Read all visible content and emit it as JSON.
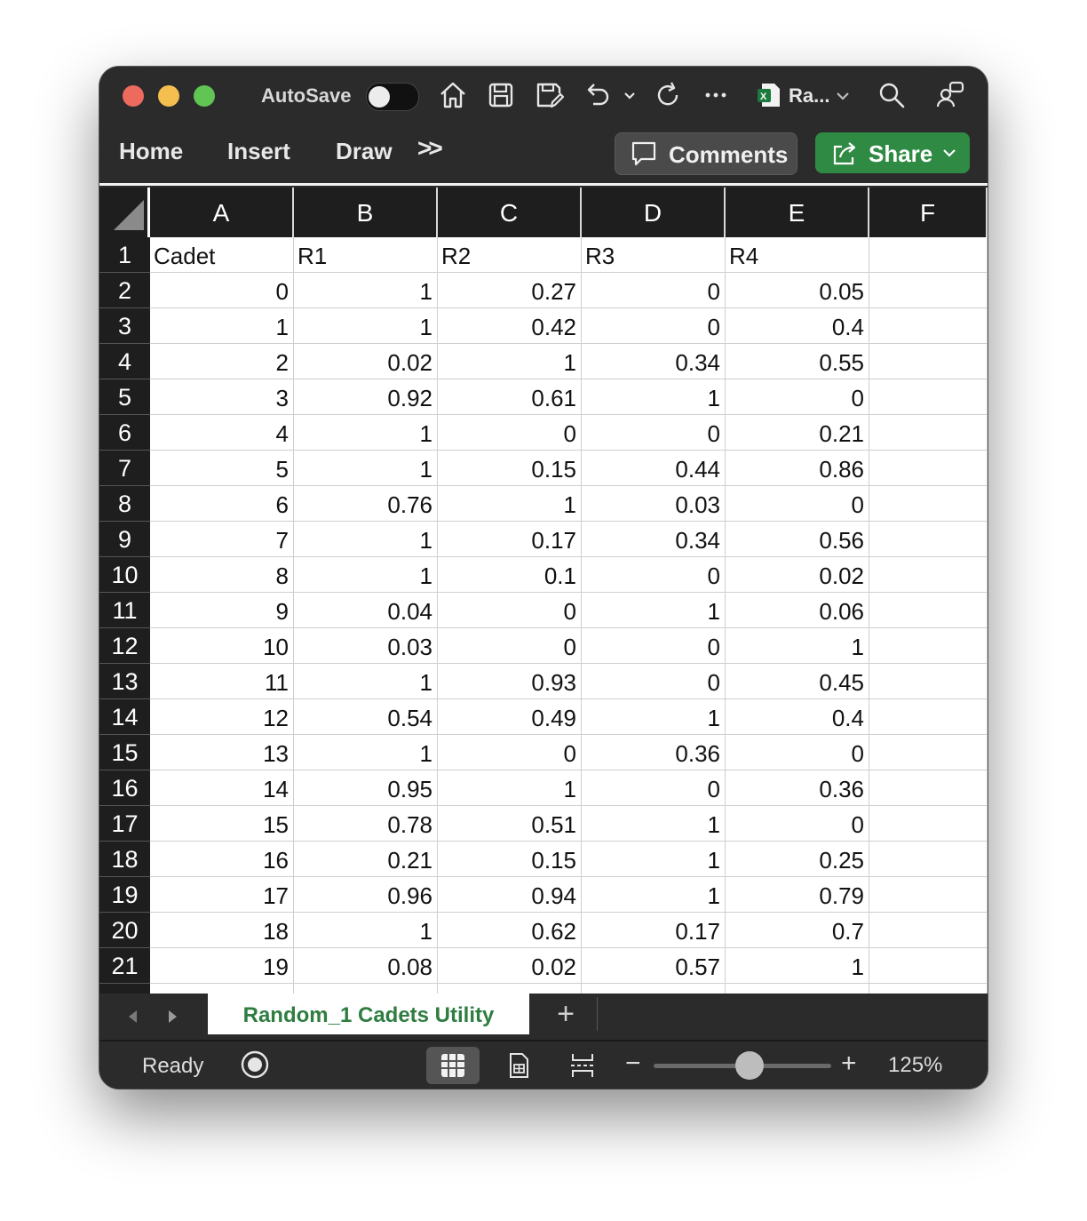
{
  "titlebar": {
    "autosave_label": "AutoSave",
    "autosave_on": false,
    "doc_title": "Ra...",
    "icons": [
      "home-icon",
      "save-icon",
      "save-as-icon",
      "undo-icon",
      "chevron-down-icon",
      "redo-icon",
      "more-icon",
      "excel-file-icon",
      "search-icon",
      "people-icon"
    ]
  },
  "ribbon": {
    "tabs": [
      "Home",
      "Insert",
      "Draw"
    ],
    "more_label": ">>",
    "comments_label": "Comments",
    "share_label": "Share",
    "share_color": "#2f8a43"
  },
  "sheet": {
    "columns": [
      "A",
      "B",
      "C",
      "D",
      "E",
      "F"
    ],
    "rows": [
      {
        "num": "1",
        "cells": [
          "Cadet",
          "R1",
          "R2",
          "R3",
          "R4",
          ""
        ]
      },
      {
        "num": "2",
        "cells": [
          "0",
          "1",
          "0.27",
          "0",
          "0.05",
          ""
        ]
      },
      {
        "num": "3",
        "cells": [
          "1",
          "1",
          "0.42",
          "0",
          "0.4",
          ""
        ]
      },
      {
        "num": "4",
        "cells": [
          "2",
          "0.02",
          "1",
          "0.34",
          "0.55",
          ""
        ]
      },
      {
        "num": "5",
        "cells": [
          "3",
          "0.92",
          "0.61",
          "1",
          "0",
          ""
        ]
      },
      {
        "num": "6",
        "cells": [
          "4",
          "1",
          "0",
          "0",
          "0.21",
          ""
        ]
      },
      {
        "num": "7",
        "cells": [
          "5",
          "1",
          "0.15",
          "0.44",
          "0.86",
          ""
        ]
      },
      {
        "num": "8",
        "cells": [
          "6",
          "0.76",
          "1",
          "0.03",
          "0",
          ""
        ]
      },
      {
        "num": "9",
        "cells": [
          "7",
          "1",
          "0.17",
          "0.34",
          "0.56",
          ""
        ]
      },
      {
        "num": "10",
        "cells": [
          "8",
          "1",
          "0.1",
          "0",
          "0.02",
          ""
        ]
      },
      {
        "num": "11",
        "cells": [
          "9",
          "0.04",
          "0",
          "1",
          "0.06",
          ""
        ]
      },
      {
        "num": "12",
        "cells": [
          "10",
          "0.03",
          "0",
          "0",
          "1",
          ""
        ]
      },
      {
        "num": "13",
        "cells": [
          "11",
          "1",
          "0.93",
          "0",
          "0.45",
          ""
        ]
      },
      {
        "num": "14",
        "cells": [
          "12",
          "0.54",
          "0.49",
          "1",
          "0.4",
          ""
        ]
      },
      {
        "num": "15",
        "cells": [
          "13",
          "1",
          "0",
          "0.36",
          "0",
          ""
        ]
      },
      {
        "num": "16",
        "cells": [
          "14",
          "0.95",
          "1",
          "0",
          "0.36",
          ""
        ]
      },
      {
        "num": "17",
        "cells": [
          "15",
          "0.78",
          "0.51",
          "1",
          "0",
          ""
        ]
      },
      {
        "num": "18",
        "cells": [
          "16",
          "0.21",
          "0.15",
          "1",
          "0.25",
          ""
        ]
      },
      {
        "num": "19",
        "cells": [
          "17",
          "0.96",
          "0.94",
          "1",
          "0.79",
          ""
        ]
      },
      {
        "num": "20",
        "cells": [
          "18",
          "1",
          "0.62",
          "0.17",
          "0.7",
          ""
        ]
      },
      {
        "num": "21",
        "cells": [
          "19",
          "0.08",
          "0.02",
          "0.57",
          "1",
          ""
        ]
      }
    ]
  },
  "sheet_tabs": {
    "active": "Random_1 Cadets Utility",
    "add_label": "+"
  },
  "statusbar": {
    "ready": "Ready",
    "zoom_minus": "−",
    "zoom_plus": "+",
    "zoom": "125%",
    "zoom_level_fraction": 0.54
  }
}
